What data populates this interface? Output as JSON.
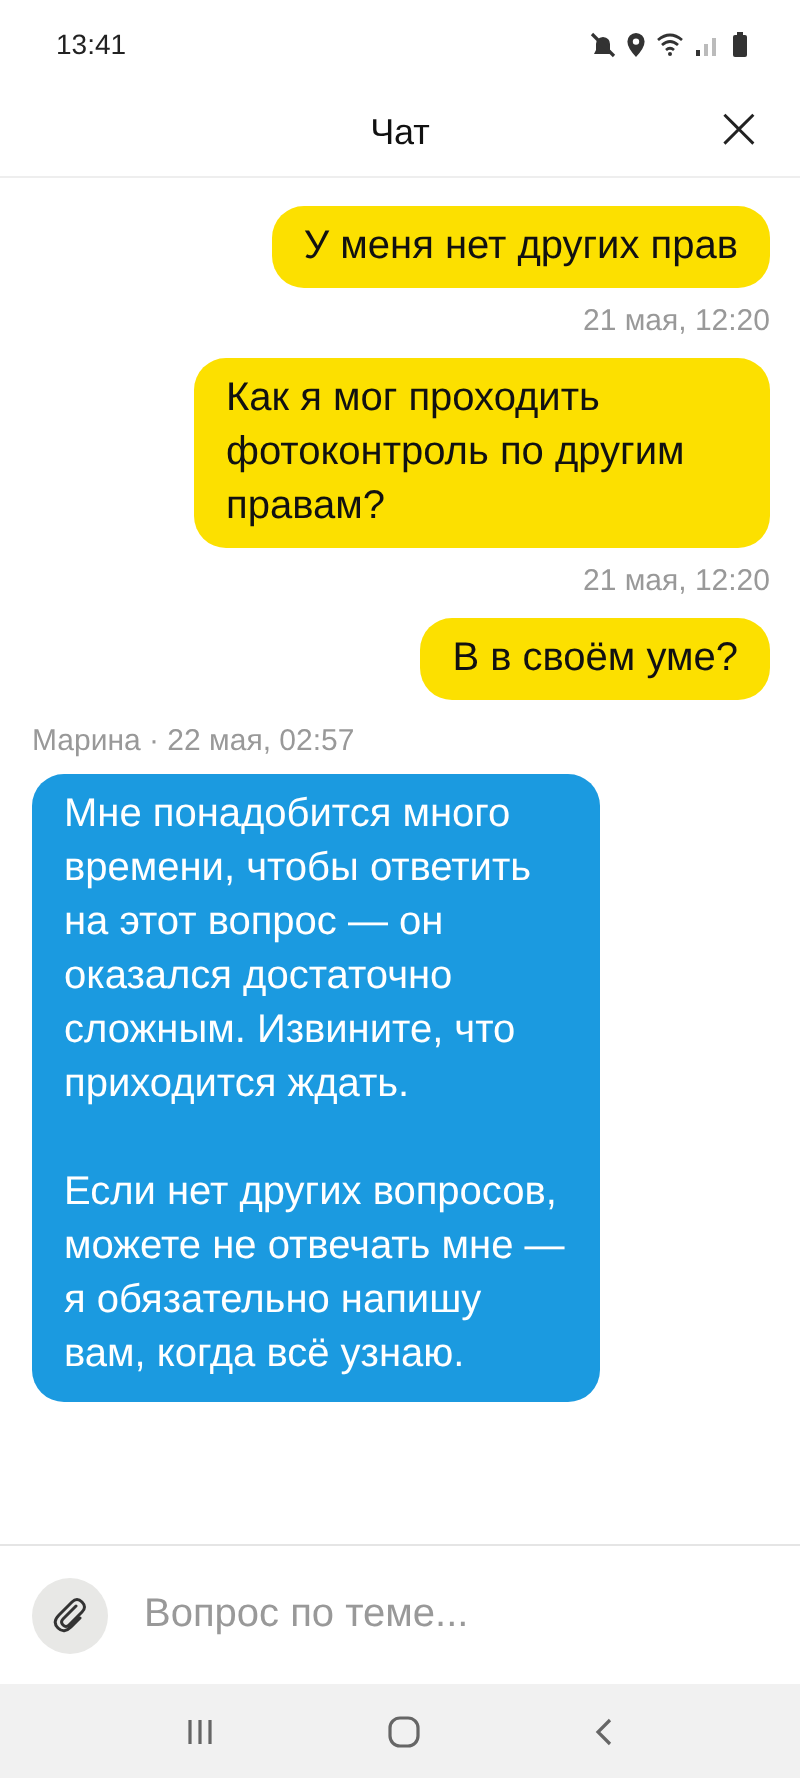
{
  "status_bar": {
    "time": "13:41"
  },
  "header": {
    "title": "Чат",
    "close": "×"
  },
  "messages": [
    {
      "outgoing": true,
      "text": "У меня нет других прав",
      "meta": "21 мая, 12:20"
    },
    {
      "outgoing": true,
      "text": "Как я мог проходить фотоконтроль по другим правам?",
      "meta": "21 мая, 12:20"
    },
    {
      "outgoing": true,
      "text": "В в своём уме?"
    },
    {
      "outgoing": false,
      "meta": "Марина · 22 мая, 02:57",
      "text": "Мне понадобится много времени, чтобы ответить на этот вопрос — он оказался достаточно сложным. Извините, что приходится ждать.\n\nЕсли нет других вопросов, можете не отвечать мне — я обязательно напишу вам, когда всё узнаю."
    }
  ],
  "composer": {
    "placeholder": "Вопрос по теме..."
  }
}
